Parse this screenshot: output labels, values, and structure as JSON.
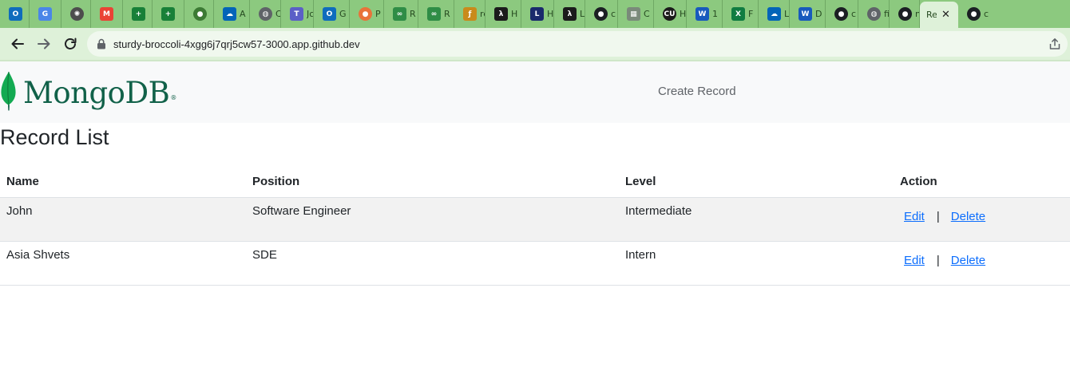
{
  "browser": {
    "tabs": [
      {
        "icon": "outlook-icon",
        "title": "",
        "color": "#0f6cbd"
      },
      {
        "icon": "google-translate-icon",
        "title": "",
        "color": "#4a86e8"
      },
      {
        "icon": "chatgpt-icon",
        "title": "",
        "color": "#4d4d4d"
      },
      {
        "icon": "gmail-icon",
        "title": "",
        "color": "#ea4335"
      },
      {
        "icon": "google-sheets-icon",
        "title": "",
        "color": "#188038"
      },
      {
        "icon": "google-sheets-icon",
        "title": "",
        "color": "#188038"
      },
      {
        "icon": "android-icon",
        "title": "",
        "color": "#3c7a34"
      },
      {
        "icon": "onedrive-icon",
        "title": "A",
        "color": "#0364b8"
      },
      {
        "icon": "globe-icon",
        "title": "C",
        "color": "#5f6368"
      },
      {
        "icon": "teams-icon",
        "title": "Jc",
        "color": "#5b5fc7"
      },
      {
        "icon": "outlook-icon",
        "title": "G",
        "color": "#0f6cbd"
      },
      {
        "icon": "basketball-icon",
        "title": "P",
        "color": "#e8733a"
      },
      {
        "icon": "geeksforgeeks-icon",
        "title": "R",
        "color": "#2f8d46"
      },
      {
        "icon": "geeksforgeeks-icon",
        "title": "R",
        "color": "#2f8d46"
      },
      {
        "icon": "code-icon",
        "title": "re",
        "color": "#c98a1b"
      },
      {
        "icon": "codeforces-icon",
        "title": "H",
        "color": "#1b1b1b"
      },
      {
        "icon": "leetcode-icon",
        "title": "H",
        "color": "#1a2a6c"
      },
      {
        "icon": "codeforces-icon",
        "title": "L",
        "color": "#1b1b1b"
      },
      {
        "icon": "github-icon",
        "title": "c",
        "color": "#1b1f23"
      },
      {
        "icon": "database-icon",
        "title": "C",
        "color": "#7a8a7a"
      },
      {
        "icon": "cu-icon",
        "title": "H",
        "color": "#1b1b1b"
      },
      {
        "icon": "word-icon",
        "title": "1",
        "color": "#185abd"
      },
      {
        "icon": "excel-icon",
        "title": "F",
        "color": "#107c41"
      },
      {
        "icon": "onedrive-icon",
        "title": "L",
        "color": "#0364b8"
      },
      {
        "icon": "word-icon",
        "title": "D",
        "color": "#185abd"
      },
      {
        "icon": "github-icon",
        "title": "c",
        "color": "#1b1f23"
      },
      {
        "icon": "globe-icon",
        "title": "fi",
        "color": "#5f6368"
      },
      {
        "icon": "github-icon",
        "title": "n",
        "color": "#1b1f23"
      }
    ],
    "active_tab": {
      "title": "Re"
    },
    "trailing_tab": {
      "icon": "github-icon",
      "title": "c"
    },
    "url": "sturdy-broccoli-4xgg6j7qrj5cw57-3000.app.github.dev"
  },
  "navbar": {
    "brand": "MongoDB",
    "brand_mark": "®",
    "brand_color": "#116149",
    "create_link": "Create Record"
  },
  "page": {
    "title": "Record List",
    "columns": [
      "Name",
      "Position",
      "Level",
      "Action"
    ],
    "rows": [
      {
        "name": "John",
        "position": "Software Engineer",
        "level": "Intermediate",
        "edit": "Edit",
        "separator": "|",
        "delete": "Delete"
      },
      {
        "name": "Asia Shvets",
        "position": "SDE",
        "level": "Intern",
        "edit": "Edit",
        "separator": "|",
        "delete": "Delete"
      }
    ]
  },
  "colors": {
    "tab_strip": "#8cc97f",
    "toolbar": "#def1d9",
    "link": "#0d6efd"
  }
}
